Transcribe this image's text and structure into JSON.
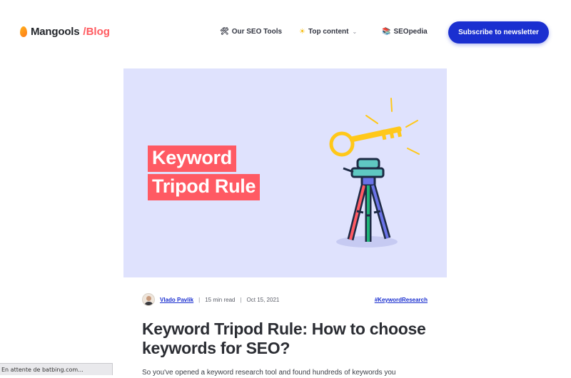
{
  "header": {
    "logo_text": "Mangools",
    "logo_slash": "/",
    "logo_section": "Blog",
    "nav": [
      {
        "icon": "🛠",
        "icon_name": "tools-icon",
        "label": "Our SEO Tools"
      },
      {
        "icon": "☀",
        "icon_name": "sun-icon",
        "label": "Top content",
        "has_dropdown": true
      },
      {
        "icon": "📚",
        "icon_name": "books-icon",
        "label": "SEOpedia"
      }
    ],
    "subscribe_label": "Subscribe to newsletter"
  },
  "hero": {
    "line1": "Keyword",
    "line2": "Tripod Rule"
  },
  "meta": {
    "author": "Vlado Pavlik",
    "read_time": "15 min read",
    "date": "Oct 15, 2021",
    "hashtag": "#KeywordResearch"
  },
  "article": {
    "title": "Keyword Tripod Rule: How to choose keywords for SEO?",
    "excerpt": "So you've opened a keyword research tool and found hundreds of keywords you"
  },
  "status_bar": {
    "text": "En attente de batbing.com..."
  },
  "colors": {
    "brand_blue": "#1a2fd0",
    "brand_red": "#ff5a5f",
    "hero_bg": "#dfe2fd",
    "key_yellow": "#ffc81a"
  }
}
